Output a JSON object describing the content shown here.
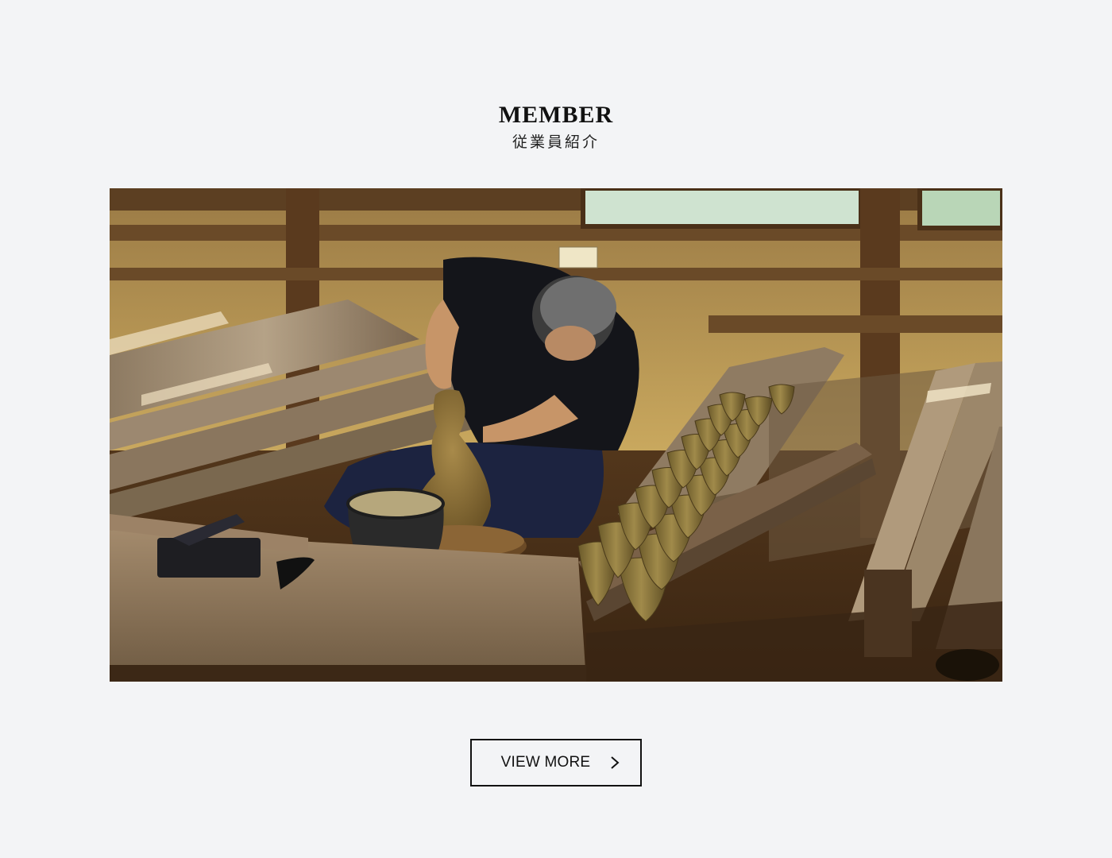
{
  "section": {
    "title": "MEMBER",
    "subtitle": "従業員紹介"
  },
  "hero_image": {
    "alt": ""
  },
  "cta": {
    "label": "VIEW MORE",
    "icon": "chevron-right-icon"
  },
  "colors": {
    "background": "#f3f4f6",
    "text": "#111111",
    "button_border": "#111111"
  }
}
